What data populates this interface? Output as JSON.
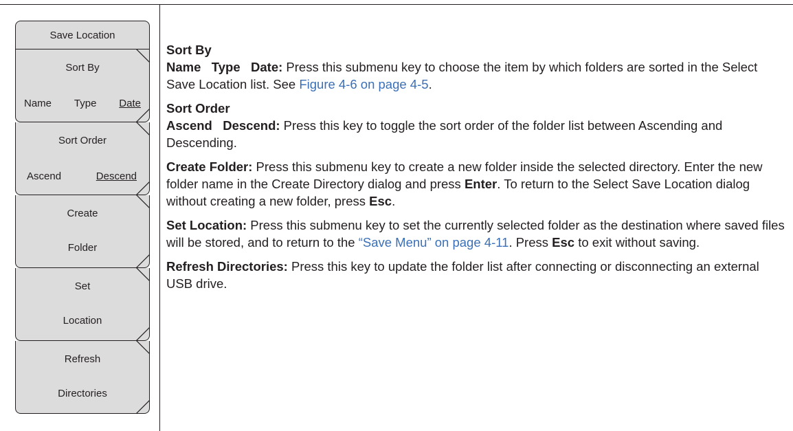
{
  "menu": {
    "title": "Save Location",
    "keys": [
      {
        "label": "Sort By",
        "options": [
          "Name",
          "Type",
          "Date"
        ]
      },
      {
        "label": "Sort Order",
        "options": [
          "Ascend",
          "Descend"
        ]
      },
      {
        "line1": "Create",
        "line2": "Folder"
      },
      {
        "line1": "Set",
        "line2": "Location"
      },
      {
        "line1": "Refresh",
        "line2": "Directories"
      }
    ]
  },
  "content": {
    "sort_by": {
      "heading": "Sort By",
      "term": "Name   Type   Date:",
      "text": " Press this submenu key to choose the item by which folders are sorted in the Select Save Location list. See ",
      "link": "Figure 4-6 on page 4-5",
      "end": "."
    },
    "sort_order": {
      "heading": "Sort Order",
      "term": "Ascend   Descend:",
      "text": " Press this key to toggle the sort order of the folder list between Ascending and Descending."
    },
    "create_folder": {
      "term": "Create Folder:",
      "text1": " Press this submenu key to create a new folder inside the selected directory. Enter the new folder name in the Create Directory dialog and press ",
      "b1": "Enter",
      "text2": ". To return to the Select Save Location dialog without creating a new folder, press ",
      "b2": "Esc",
      "text3": "."
    },
    "set_location": {
      "term": "Set Location:",
      "text1": " Press this submenu key to set the currently selected folder as the destination where saved files will be stored, and to return to the ",
      "link": "“Save Menu” on page 4-11",
      "text2": ". Press ",
      "b1": "Esc",
      "text3": " to exit without saving."
    },
    "refresh_directories": {
      "term": "Refresh Directories:",
      "text": " Press this key to update the folder list after connecting or disconnecting an external USB drive."
    }
  }
}
